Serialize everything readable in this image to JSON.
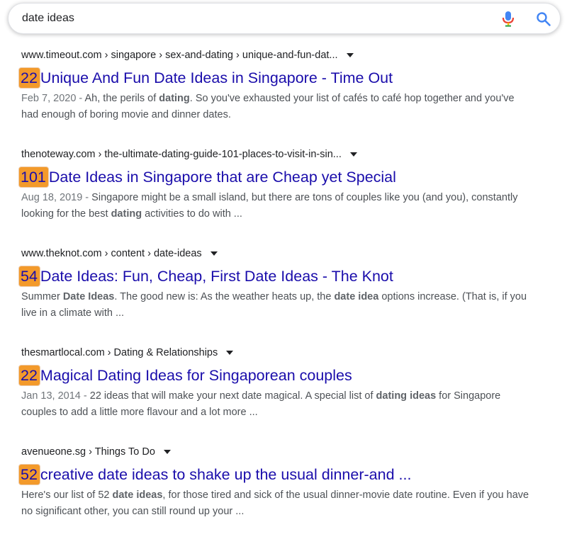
{
  "search": {
    "query": "date ideas"
  },
  "icons": {
    "mic": "microphone-icon",
    "search": "magnifier-icon"
  },
  "colors": {
    "link": "#1a0dab",
    "badge": "#f39a2b",
    "snippet": "#4d5156"
  },
  "results": [
    {
      "url": "www.timeout.com › singapore › sex-and-dating › unique-and-fun-dat...",
      "badge": "22",
      "title": "Unique And Fun Date Ideas in Singapore - Time Out",
      "date": "Feb 7, 2020",
      "snippet_parts": [
        {
          "t": "Ah, the perils of ",
          "b": false
        },
        {
          "t": "dating",
          "b": true
        },
        {
          "t": ". So you've exhausted your list of cafés to café hop together and you've had enough of boring movie and dinner dates.",
          "b": false
        }
      ]
    },
    {
      "url": "thenoteway.com › the-ultimate-dating-guide-101-places-to-visit-in-sin...",
      "badge": "101",
      "title": "Date Ideas in Singapore that are Cheap yet Special",
      "date": "Aug 18, 2019",
      "snippet_parts": [
        {
          "t": "Singapore might be a small island, but there are tons of couples like you (and you), constantly looking for the best ",
          "b": false
        },
        {
          "t": "dating",
          "b": true
        },
        {
          "t": " activities to do with ...",
          "b": false
        }
      ]
    },
    {
      "url": "www.theknot.com › content › date-ideas",
      "badge": "54",
      "title": "Date Ideas: Fun, Cheap, First Date Ideas - The Knot",
      "date": "",
      "snippet_parts": [
        {
          "t": "Summer ",
          "b": false
        },
        {
          "t": "Date Ideas",
          "b": true
        },
        {
          "t": ". The good new is: As the weather heats up, the ",
          "b": false
        },
        {
          "t": "date idea",
          "b": true
        },
        {
          "t": " options increase. (That is, if you live in a climate with ...",
          "b": false
        }
      ]
    },
    {
      "url": "thesmartlocal.com › Dating & Relationships",
      "badge": "22",
      "title": "Magical Dating Ideas for Singaporean couples",
      "date": "Jan 13, 2014",
      "snippet_parts": [
        {
          "t": "22 ideas that will make your next date magical. A special list of ",
          "b": false
        },
        {
          "t": "dating ideas",
          "b": true
        },
        {
          "t": " for Singapore couples to add a little more flavour and a lot more ...",
          "b": false
        }
      ]
    },
    {
      "url": "avenueone.sg › Things To Do",
      "badge": "52",
      "title": "creative date ideas to shake up the usual dinner-and ...",
      "date": "",
      "snippet_parts": [
        {
          "t": "Here's our list of 52 ",
          "b": false
        },
        {
          "t": "date ideas",
          "b": true
        },
        {
          "t": ", for those tired and sick of the usual dinner-movie date routine. Even if you have no significant other, you can still round up your ...",
          "b": false
        }
      ]
    }
  ]
}
